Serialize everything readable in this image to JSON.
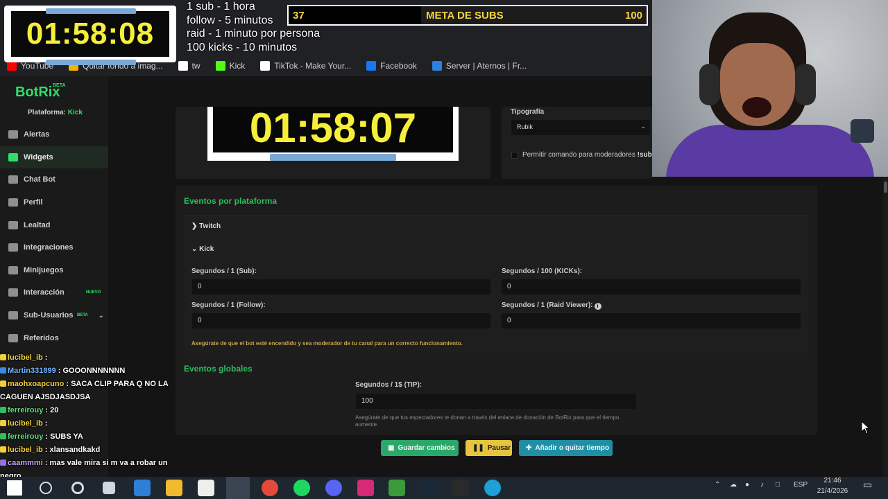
{
  "overlay": {
    "timer": "01:58:08",
    "rules": [
      "1 sub - 1 hora",
      "follow - 5 minutos",
      "raid - 1 minuto por persona",
      "100 kicks - 10 minutos"
    ],
    "meta": {
      "current": "37",
      "title": "META DE SUBS",
      "goal": "100",
      "progress": 0.37
    }
  },
  "bookmarks": [
    {
      "label": "YouTube",
      "color": "#ff0000"
    },
    {
      "label": "Quitar fondo a imag...",
      "color": "#f0b400"
    },
    {
      "label": "tw",
      "color": "#ffffff"
    },
    {
      "label": "Kick",
      "color": "#53fc18"
    },
    {
      "label": "TikTok - Make Your...",
      "color": "#ffffff"
    },
    {
      "label": "Facebook",
      "color": "#1877f2"
    },
    {
      "label": "Server | Aternos | Fr...",
      "color": "#2d7fe0"
    }
  ],
  "sidebar": {
    "logo": "BotRix",
    "logo_badge": "BETA",
    "platform_label": "Plataforma:",
    "platform_value": "Kick",
    "items": [
      {
        "label": "Alertas",
        "icon": "warning-icon"
      },
      {
        "label": "Widgets",
        "icon": "grid-icon",
        "active": true
      },
      {
        "label": "Chat Bot",
        "icon": "bot-icon"
      },
      {
        "label": "Perfil",
        "icon": "profile-icon"
      },
      {
        "label": "Lealtad",
        "icon": "trophy-icon"
      },
      {
        "label": "Integraciones",
        "icon": "integration-icon"
      },
      {
        "label": "Minijuegos",
        "icon": "gamepad-icon"
      },
      {
        "label": "Interacción",
        "icon": "music-icon",
        "badge": "NUEVO"
      },
      {
        "label": "Sub-Usuarios",
        "icon": "users-icon",
        "badge": "BETA"
      },
      {
        "label": "Referidos",
        "icon": "referral-icon"
      }
    ]
  },
  "preview": {
    "timer": "01:58:07"
  },
  "settings": {
    "typography_label": "Tipografía",
    "typography_value": "Rubik",
    "mod_label": "Permitir comando para moderadores",
    "mod_cmd": "!sub"
  },
  "events": {
    "title": "Eventos por plataforma",
    "twitch": "Twitch",
    "kick": "Kick",
    "fields": [
      {
        "label": "Segundos / 1 (Sub):",
        "value": "0"
      },
      {
        "label": "Segundos / 100 (KICKs):",
        "value": "0"
      },
      {
        "label": "Segundos / 1 (Follow):",
        "value": "0"
      },
      {
        "label": "Segundos / 1 (Raid Viewer):",
        "value": "0"
      }
    ],
    "note": "Asegúrate de que el bot esté encendido y sea moderador de tu canal para un correcto funcionamiento."
  },
  "global": {
    "title": "Eventos globales",
    "tip_label": "Segundos / 1$ (TIP):",
    "tip_value": "100",
    "note": "Asegúrate de que tus espectadores te donan a través del enlace de donación de BotRix para que el tiempo aumente."
  },
  "buttons": {
    "save": "Guardar cambios",
    "pause": "Pausar",
    "add": "Añadir o quitar tiempo"
  },
  "chat": [
    {
      "name": "lucibel_ib",
      "msg": " :",
      "color": "yellow"
    },
    {
      "name": "Martin331899",
      "msg": " : GOOONNNNNNN",
      "color": "blue"
    },
    {
      "name": "maohxoapcuno",
      "msg": " : SACA CLIP PARA Q NO LA",
      "color": "yellow"
    },
    {
      "name": "",
      "msg": "CAGUEN AJSDJASDJSA",
      "color": "none"
    },
    {
      "name": "ferreirouy",
      "msg": " : 20",
      "color": "green"
    },
    {
      "name": "lucibel_ib",
      "msg": " :",
      "color": "yellow"
    },
    {
      "name": "ferreirouy",
      "msg": " : SUBS YA",
      "color": "green"
    },
    {
      "name": "lucibel_ib",
      "msg": " : xlansandkakd",
      "color": "yellow"
    },
    {
      "name": "caammmi",
      "msg": " : mas vale mira si m va a robar un",
      "color": "purple"
    },
    {
      "name": "",
      "msg": "negro",
      "color": "none"
    }
  ],
  "taskbar": {
    "lang": "ESP",
    "time": "21:46",
    "date": "21/4/2026"
  }
}
